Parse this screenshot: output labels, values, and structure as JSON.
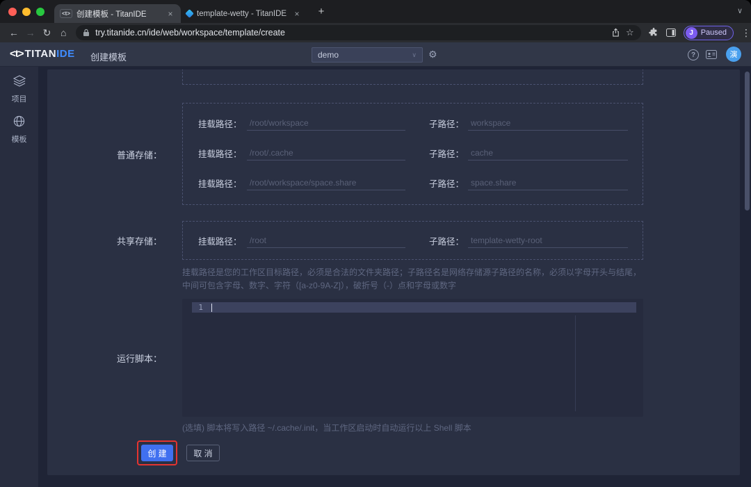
{
  "browser": {
    "tabs": [
      {
        "title": "创建模板 - TitanIDE"
      },
      {
        "title": "template-wetty - TitanIDE"
      }
    ],
    "url": "try.titanide.cn/ide/web/workspace/template/create",
    "profile": {
      "initial": "J",
      "status": "Paused"
    }
  },
  "icons": {
    "back": "←",
    "forward": "→",
    "reload": "↻",
    "home": "⌂",
    "star": "☆",
    "menu": "⋮",
    "gear": "⚙",
    "help": "?",
    "chevron_down": "∨",
    "new_tab": "+",
    "close": "×"
  },
  "header": {
    "logo_mark": "<t>",
    "logo_titan": "TITAN",
    "logo_ide": "IDE",
    "page_title": "创建模板",
    "workspace_select": "demo",
    "avatar_text": "演"
  },
  "sidebar": {
    "items": [
      {
        "label": "项目"
      },
      {
        "label": "模板"
      }
    ]
  },
  "form": {
    "normal_storage": {
      "label": "普通存储：",
      "mount_label": "挂载路径：",
      "sub_label": "子路径：",
      "rows": [
        {
          "mount_placeholder": "/root/workspace",
          "sub_placeholder": "workspace"
        },
        {
          "mount_placeholder": "/root/.cache",
          "sub_placeholder": "cache"
        },
        {
          "mount_placeholder": "/root/workspace/space.share",
          "sub_placeholder": "space.share"
        }
      ]
    },
    "shared_storage": {
      "label": "共享存储：",
      "mount_label": "挂载路径：",
      "sub_label": "子路径：",
      "rows": [
        {
          "mount_placeholder": "/root",
          "sub_placeholder": "template-wetty-root"
        }
      ]
    },
    "path_hint": "挂载路径是您的工作区目标路径，必须是合法的文件夹路径；子路径名是网络存储源子路径的名称，必须以字母开头与结尾，中间可包含字母、数字、字符（[a-z0-9A-Z]），破折号（-）点和字母或数字",
    "script": {
      "label": "运行脚本：",
      "line_number": "1",
      "hint": "(选填) 脚本将写入路径 ~/.cache/.init，当工作区启动时自动运行以上 Shell 脚本"
    },
    "buttons": {
      "create": "创 建",
      "cancel": "取 消"
    }
  },
  "colors": {
    "accent_blue": "#4070f0",
    "annotation_red": "#e53430",
    "logo_blue": "#3f8cff",
    "avatar_blue": "#4aa0ee"
  }
}
